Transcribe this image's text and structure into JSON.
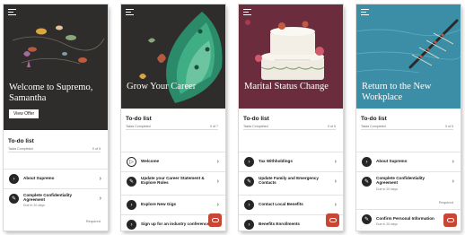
{
  "screens": [
    {
      "hero_title": "Welcome to Supremo, Samantha",
      "button_label": "View Offer",
      "todo_title": "To-do list",
      "tasks_label": "Tasks Completed",
      "tasks_count": "0 of 5",
      "items": [
        {
          "label": "About Supremo",
          "icon": "arrow-right-icon"
        },
        {
          "label": "Complete Confidentiality Agreement",
          "sub": "Due in 20 days",
          "icon": "pencil-icon"
        }
      ],
      "required_label": "Required"
    },
    {
      "hero_title": "Grow Your Career",
      "todo_title": "To-do list",
      "tasks_label": "Tasks Completed",
      "tasks_count": "0 of 7",
      "items": [
        {
          "label": "Welcome",
          "icon": "play-icon"
        },
        {
          "label": "Update your Career Statement & Explore Roles",
          "icon": "pencil-icon"
        },
        {
          "label": "Explore New Gigs",
          "icon": "arrow-right-icon"
        },
        {
          "label": "Sign up for an industry conference",
          "icon": "arrow-right-icon"
        }
      ]
    },
    {
      "hero_title": "Marital Status Change",
      "todo_title": "To-do list",
      "tasks_label": "Tasks Completed",
      "tasks_count": "0 of 5",
      "items": [
        {
          "label": "Tax Withholdings",
          "icon": "arrow-right-icon"
        },
        {
          "label": "Update Family and Emergency Contacts",
          "icon": "pencil-icon"
        },
        {
          "label": "Contact Local Benefits",
          "icon": "arrow-right-icon"
        },
        {
          "label": "Benefits Enrollments",
          "icon": "arrow-right-icon"
        }
      ]
    },
    {
      "hero_title": "Return to the New Workplace",
      "todo_title": "To-do list",
      "tasks_label": "Tasks Completed",
      "tasks_count": "0 of 5",
      "items": [
        {
          "label": "About Supremo",
          "icon": "arrow-right-icon"
        },
        {
          "label": "Complete Confidentiality Agreement",
          "sub": "Due in 20 days",
          "icon": "pencil-icon"
        },
        {
          "label": "Confirm Personal Information",
          "sub": "Due in 20 days",
          "icon": "pencil-icon"
        }
      ],
      "required_label": "Required"
    }
  ],
  "colors": {
    "accent": "#c74634",
    "hero_dark": "#2e2d2b",
    "hero_green": "#2d5a45",
    "hero_maroon": "#6b2c3e",
    "hero_teal": "#3b8ea5"
  }
}
